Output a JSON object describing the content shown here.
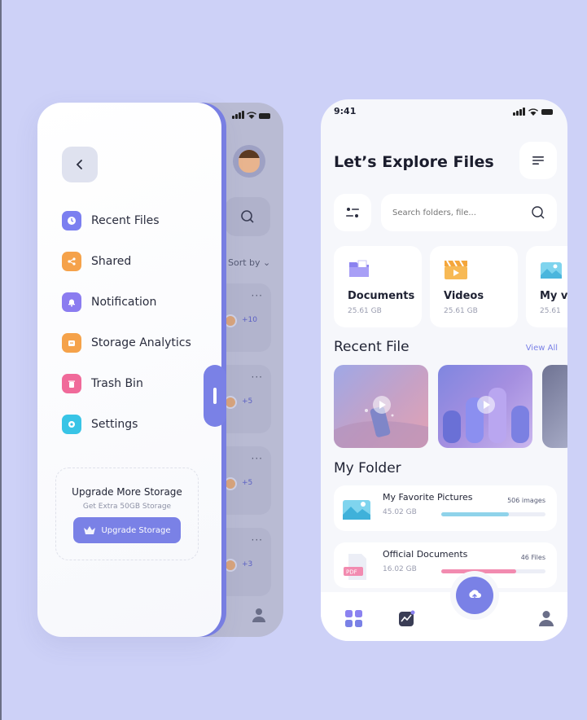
{
  "drawer": {
    "menu": [
      {
        "label": "Recent Files",
        "icon": "clock-icon",
        "color": "#7b7ff0"
      },
      {
        "label": "Shared",
        "icon": "share-icon",
        "color": "#f5a24a"
      },
      {
        "label": "Notification",
        "icon": "bell-icon",
        "color": "#8b7cf0"
      },
      {
        "label": "Storage Analytics",
        "icon": "storage-icon",
        "color": "#f5a24a"
      },
      {
        "label": "Trash Bin",
        "icon": "trash-icon",
        "color": "#f06a9a"
      },
      {
        "label": "Settings",
        "icon": "gear-icon",
        "color": "#38c4e6"
      }
    ],
    "upgrade": {
      "title": "Upgrade More Storage",
      "subtitle": "Get Extra 50GB Storage",
      "button_label": "Upgrade Storage"
    }
  },
  "back_screen": {
    "sort_label": "Sort by",
    "counts": [
      "+10",
      "+5",
      "+5",
      "+3"
    ]
  },
  "main": {
    "status_time": "9:41",
    "title": "Let’s Explore Files",
    "search_placeholder": "Search folders, file...",
    "categories": [
      {
        "name": "Documents",
        "size": "25.61 GB"
      },
      {
        "name": "Videos",
        "size": "25.61 GB"
      },
      {
        "name": "My v",
        "size": "25.61"
      }
    ],
    "recent_title": "Recent File",
    "view_all": "View All",
    "folder_title": "My Folder",
    "folders": [
      {
        "name": "My Favorite Pictures",
        "size": "45.02 GB",
        "count": "506 images",
        "progress": 0.65,
        "color": "#8fd3ea"
      },
      {
        "name": "Official Documents",
        "size": "16.02 GB",
        "count": "46 Files",
        "progress": 0.72,
        "color": "#f28bb0"
      }
    ]
  },
  "colors": {
    "accent": "#7a81e6",
    "background": "#cdd1f7"
  }
}
